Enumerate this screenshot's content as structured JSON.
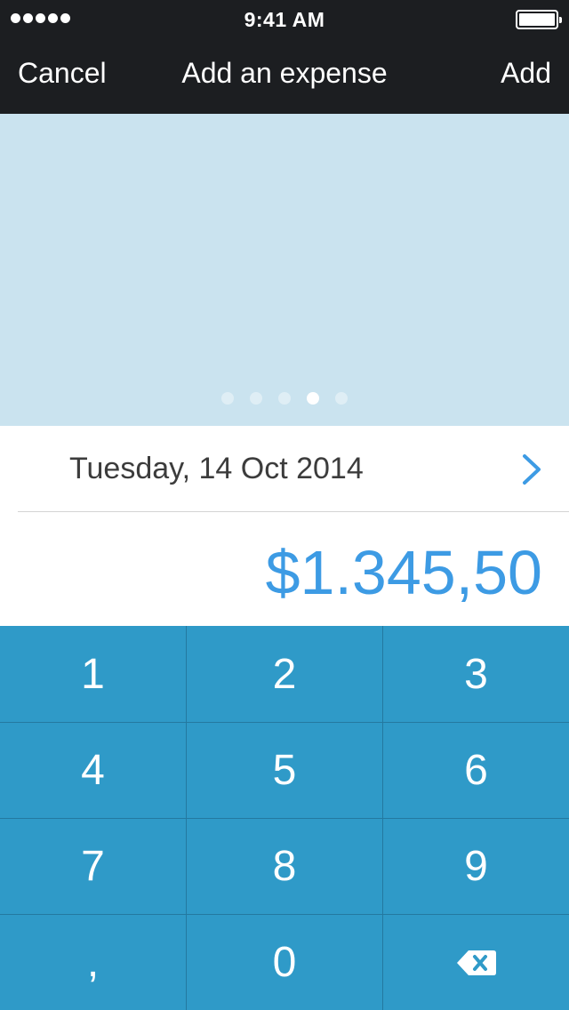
{
  "status_bar": {
    "time": "9:41 AM",
    "signal_icon": "signal-dots-icon",
    "battery_icon": "battery-icon"
  },
  "nav": {
    "cancel_label": "Cancel",
    "title": "Add an expense",
    "add_label": "Add"
  },
  "carousel": {
    "page_count": 5,
    "active_page_index": 3
  },
  "date_row": {
    "label": "Tuesday, 14 Oct 2014",
    "icon": "chevron-right-icon"
  },
  "amount": {
    "display": "$1.345,50"
  },
  "keypad": {
    "keys": [
      "1",
      "2",
      "3",
      "4",
      "5",
      "6",
      "7",
      "8",
      "9",
      ",",
      "0",
      ""
    ],
    "backspace_icon": "backspace-icon"
  },
  "colors": {
    "nav_background": "#1c1e21",
    "carousel_background": "#cae3ef",
    "amount_text": "#3d9be4",
    "chevron": "#3d9be4",
    "keypad_background": "#2f9ac8",
    "keypad_separator": "#2479a0"
  }
}
